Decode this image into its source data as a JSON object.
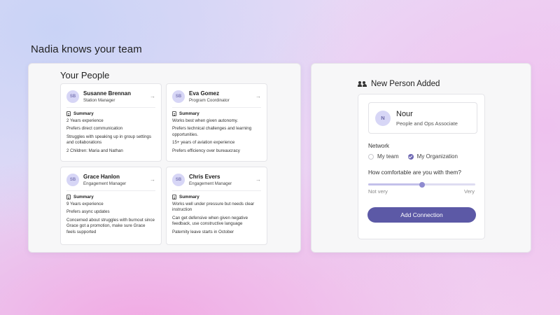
{
  "headline": "Nadia knows your team",
  "people_panel": {
    "title": "Your People",
    "summary_label": "Summary",
    "people": [
      {
        "initials": "SB",
        "name": "Susanne Brennan",
        "role": "Station Manager",
        "facts": [
          "2 Years experience",
          "Prefers direct communication",
          "Struggles with speaking up in group settings and collaborations",
          "2 Children: Maria and Nathan"
        ]
      },
      {
        "initials": "SB",
        "name": "Eva Gomez",
        "role": "Program Coordinator",
        "facts": [
          "Works best when given autonomy.",
          "Prefers technical challenges and learning opportunities.",
          "15+ years of aviation experience",
          "Prefers efficiency over bureaucracy"
        ]
      },
      {
        "initials": "SB",
        "name": "Grace Hanlon",
        "role": "Engagement Manager",
        "facts": [
          "9 Years experience",
          "Prefers async updates",
          "Concerned about struggles with burnout since Grace got a promotion, make sure Grace feels supported"
        ]
      },
      {
        "initials": "SB",
        "name": "Chris Evers",
        "role": "Engagement Manager",
        "facts": [
          "Works well under pressure but needs clear instruction",
          "Can get defensive when given negative feedback, use constructive language",
          "Paternity leave starts in October"
        ]
      }
    ]
  },
  "new_person_panel": {
    "title": "New Person Added",
    "person": {
      "initials": "N",
      "name": "Nour",
      "role": "People and Ops Associate"
    },
    "network_label": "Network",
    "network_options": [
      {
        "label": "My team",
        "selected": false
      },
      {
        "label": "My Organization",
        "selected": true
      }
    ],
    "comfort_question": "How comfortable are you with them?",
    "comfort_value": 0.5,
    "comfort_min_label": "Not very",
    "comfort_max_label": "Very",
    "add_button_label": "Add Connection"
  },
  "colors": {
    "accent": "#5c59a6",
    "avatar_bg": "#d7d6f6",
    "radio_selected": "#6e68b3"
  },
  "icons": {
    "arrow": "arrow-right-icon",
    "summary": "document-icon",
    "new_person": "people-icon"
  }
}
